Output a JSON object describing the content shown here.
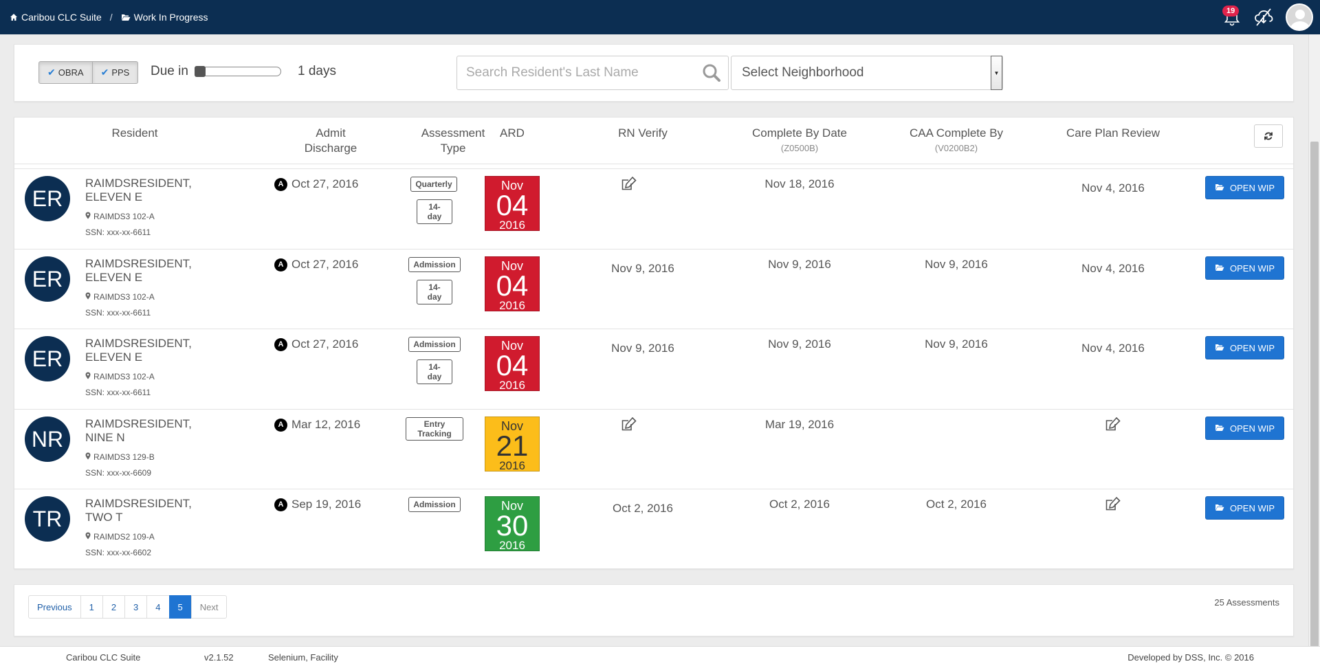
{
  "nav": {
    "app_name": "Caribou CLC Suite",
    "separator": "/",
    "page_name": "Work In Progress",
    "notification_count": "19"
  },
  "filters": {
    "obra_label": "OBRA",
    "pps_label": "PPS",
    "due_label": "Due in",
    "due_value_fraction": 0.0,
    "days_label": "1 days",
    "search_placeholder": "Search Resident's Last Name",
    "neighborhood_label": "Select Neighborhood"
  },
  "table": {
    "headers": {
      "resident": "Resident",
      "admit": "Admit",
      "discharge": "Discharge",
      "assessment": "Assessment",
      "type": "Type",
      "ard": "ARD",
      "rn_verify": "RN Verify",
      "complete_by": "Complete By Date",
      "complete_by_sub": "(Z0500B)",
      "caa": "CAA Complete By",
      "caa_sub": "(V0200B2)",
      "care_plan": "Care Plan Review"
    },
    "rows": [
      {
        "initials": "ER",
        "name_line1": "RAIMDSRESIDENT,",
        "name_line2": "ELEVEN E",
        "room": "RAIMDS3 102-A",
        "ssn": "SSN: xxx-xx-6611",
        "admit_badge": "A",
        "admit_date": "Oct 27, 2016",
        "type1": "Quarterly",
        "type2": "14-day",
        "ard_month": "Nov",
        "ard_day": "04",
        "ard_year": "2016",
        "ard_color": "red",
        "rn_verify": "",
        "rn_verify_icon": true,
        "complete_by": "Nov 18, 2016",
        "caa": "",
        "care_plan": "Nov 4, 2016",
        "care_plan_icon": false,
        "open_label": "OPEN WIP"
      },
      {
        "initials": "ER",
        "name_line1": "RAIMDSRESIDENT,",
        "name_line2": "ELEVEN E",
        "room": "RAIMDS3 102-A",
        "ssn": "SSN: xxx-xx-6611",
        "admit_badge": "A",
        "admit_date": "Oct 27, 2016",
        "type1": "Admission",
        "type2": "14-day",
        "ard_month": "Nov",
        "ard_day": "04",
        "ard_year": "2016",
        "ard_color": "red",
        "rn_verify": "Nov 9, 2016",
        "rn_verify_icon": false,
        "complete_by": "Nov 9, 2016",
        "caa": "Nov 9, 2016",
        "care_plan": "Nov 4, 2016",
        "care_plan_icon": false,
        "open_label": "OPEN WIP"
      },
      {
        "initials": "ER",
        "name_line1": "RAIMDSRESIDENT,",
        "name_line2": "ELEVEN E",
        "room": "RAIMDS3 102-A",
        "ssn": "SSN: xxx-xx-6611",
        "admit_badge": "A",
        "admit_date": "Oct 27, 2016",
        "type1": "Admission",
        "type2": "14-day",
        "ard_month": "Nov",
        "ard_day": "04",
        "ard_year": "2016",
        "ard_color": "red",
        "rn_verify": "Nov 9, 2016",
        "rn_verify_icon": false,
        "complete_by": "Nov 9, 2016",
        "caa": "Nov 9, 2016",
        "care_plan": "Nov 4, 2016",
        "care_plan_icon": false,
        "open_label": "OPEN WIP"
      },
      {
        "initials": "NR",
        "name_line1": "RAIMDSRESIDENT,",
        "name_line2": "NINE N",
        "room": "RAIMDS3 129-B",
        "ssn": "SSN: xxx-xx-6609",
        "admit_badge": "A",
        "admit_date": "Mar 12, 2016",
        "type1": "Entry Tracking",
        "type2": "",
        "ard_month": "Nov",
        "ard_day": "21",
        "ard_year": "2016",
        "ard_color": "yellow",
        "rn_verify": "",
        "rn_verify_icon": true,
        "complete_by": "Mar 19, 2016",
        "caa": "",
        "care_plan": "",
        "care_plan_icon": true,
        "open_label": "OPEN WIP"
      },
      {
        "initials": "TR",
        "name_line1": "RAIMDSRESIDENT,",
        "name_line2": "TWO T",
        "room": "RAIMDS2 109-A",
        "ssn": "SSN: xxx-xx-6602",
        "admit_badge": "A",
        "admit_date": "Sep 19, 2016",
        "type1": "Admission",
        "type2": "",
        "ard_month": "Nov",
        "ard_day": "30",
        "ard_year": "2016",
        "ard_color": "green",
        "rn_verify": "Oct 2, 2016",
        "rn_verify_icon": false,
        "complete_by": "Oct 2, 2016",
        "caa": "Oct 2, 2016",
        "care_plan": "",
        "care_plan_icon": true,
        "open_label": "OPEN WIP"
      }
    ]
  },
  "pagination": {
    "previous": "Previous",
    "pages": [
      "1",
      "2",
      "3",
      "4",
      "5"
    ],
    "active_page": "5",
    "next": "Next",
    "count_label": "25 Assessments"
  },
  "footer": {
    "app_name": "Caribou CLC Suite",
    "version": "v2.1.52",
    "user": "Selenium, Facility",
    "copyright": "Developed by DSS, Inc. © 2016"
  },
  "colors": {
    "navy": "#0c2e52",
    "ard_red": "#d01b2e",
    "ard_yellow": "#fcbd1a",
    "ard_green": "#2e9e42",
    "button_blue": "#1f74d2"
  }
}
